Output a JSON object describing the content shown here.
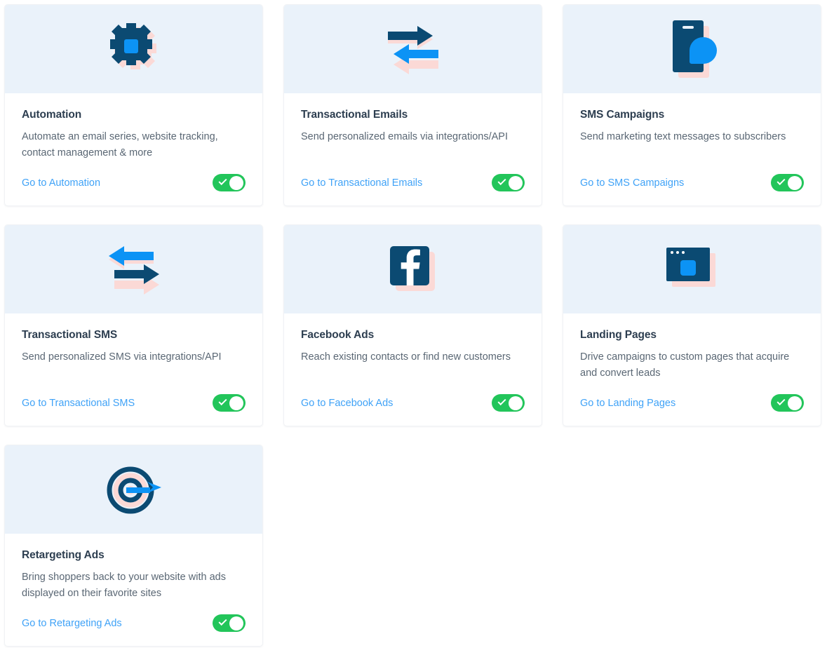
{
  "theme": {
    "page_bg": "#ffffff",
    "card_bg": "#ffffff",
    "media_bg": "#eaf2fa",
    "title_color": "#2d3e50",
    "desc_color": "#5a6774",
    "link_color": "#3fa2f7",
    "toggle_on_color": "#22c55a",
    "icon_navy": "#0b4a72",
    "icon_blue": "#0c93f5",
    "icon_shadow_pink": "#fbd9d6"
  },
  "cards": [
    {
      "id": "automation",
      "icon": "gear-icon",
      "title": "Automation",
      "description": "Automate an email series, website tracking, contact management & more",
      "link_label": "Go to Automation",
      "toggle_state": "on"
    },
    {
      "id": "transactional-emails",
      "icon": "arrows-exchange-icon",
      "title": "Transactional Emails",
      "description": "Send personalized emails via integrations/API",
      "link_label": "Go to Transactional Emails",
      "toggle_state": "on"
    },
    {
      "id": "sms-campaigns",
      "icon": "phone-message-icon",
      "title": "SMS Campaigns",
      "description": "Send marketing text messages to subscribers",
      "link_label": "Go to SMS Campaigns",
      "toggle_state": "on"
    },
    {
      "id": "transactional-sms",
      "icon": "arrows-exchange-reverse-icon",
      "title": "Transactional SMS",
      "description": "Send personalized SMS via integrations/API",
      "link_label": "Go to Transactional SMS",
      "toggle_state": "on"
    },
    {
      "id": "facebook-ads",
      "icon": "facebook-icon",
      "title": "Facebook Ads",
      "description": "Reach existing contacts or find new customers",
      "link_label": "Go to Facebook Ads",
      "toggle_state": "on"
    },
    {
      "id": "landing-pages",
      "icon": "browser-window-icon",
      "title": "Landing Pages",
      "description": "Drive campaigns to custom pages that acquire and convert leads",
      "link_label": "Go to Landing Pages",
      "toggle_state": "on"
    },
    {
      "id": "retargeting-ads",
      "icon": "target-dart-icon",
      "title": "Retargeting Ads",
      "description": "Bring shoppers back to your website with ads displayed on their favorite sites",
      "link_label": "Go to Retargeting Ads",
      "toggle_state": "on"
    }
  ]
}
